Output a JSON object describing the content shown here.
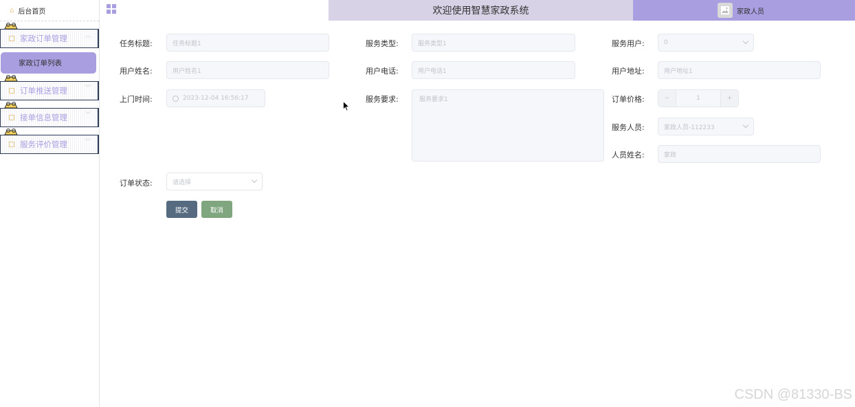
{
  "sidebar": {
    "home": "后台首页",
    "menus": [
      {
        "label": "家政订单管理"
      },
      {
        "label": "订单推送管理"
      },
      {
        "label": "接单信息管理"
      },
      {
        "label": "服务评价管理"
      }
    ],
    "sub_item": "家政订单列表"
  },
  "header": {
    "title": "欢迎使用智慧家政系统",
    "user": "家政人员"
  },
  "form": {
    "task_title": {
      "label": "任务标题:",
      "placeholder": "任务标题1"
    },
    "service_type": {
      "label": "服务类型:",
      "placeholder": "服务类型1"
    },
    "service_user": {
      "label": "服务用户:",
      "value": "0"
    },
    "user_name": {
      "label": "用户姓名:",
      "placeholder": "用户姓名1"
    },
    "user_phone": {
      "label": "用户电话:",
      "placeholder": "用户电话1"
    },
    "user_address": {
      "label": "用户地址:",
      "placeholder": "用户地址1"
    },
    "visit_time": {
      "label": "上门时间:",
      "value": "2023-12-04 16:56:17"
    },
    "service_req": {
      "label": "服务要求:",
      "placeholder": "服务要求1"
    },
    "order_price": {
      "label": "订单价格:",
      "value": "1",
      "minus": "−",
      "plus": "+"
    },
    "service_staff": {
      "label": "服务人员:",
      "value": "家政人员-112233"
    },
    "staff_name": {
      "label": "人员姓名:",
      "value": "家政"
    },
    "order_status": {
      "label": "订单状态:",
      "placeholder": "请选择"
    },
    "submit": "提交",
    "cancel": "取消"
  },
  "watermark": "CSDN @81330-BS",
  "colors": {
    "accent": "#a99ee0",
    "submit": "#566b7f",
    "cancel": "#7fa67f"
  }
}
